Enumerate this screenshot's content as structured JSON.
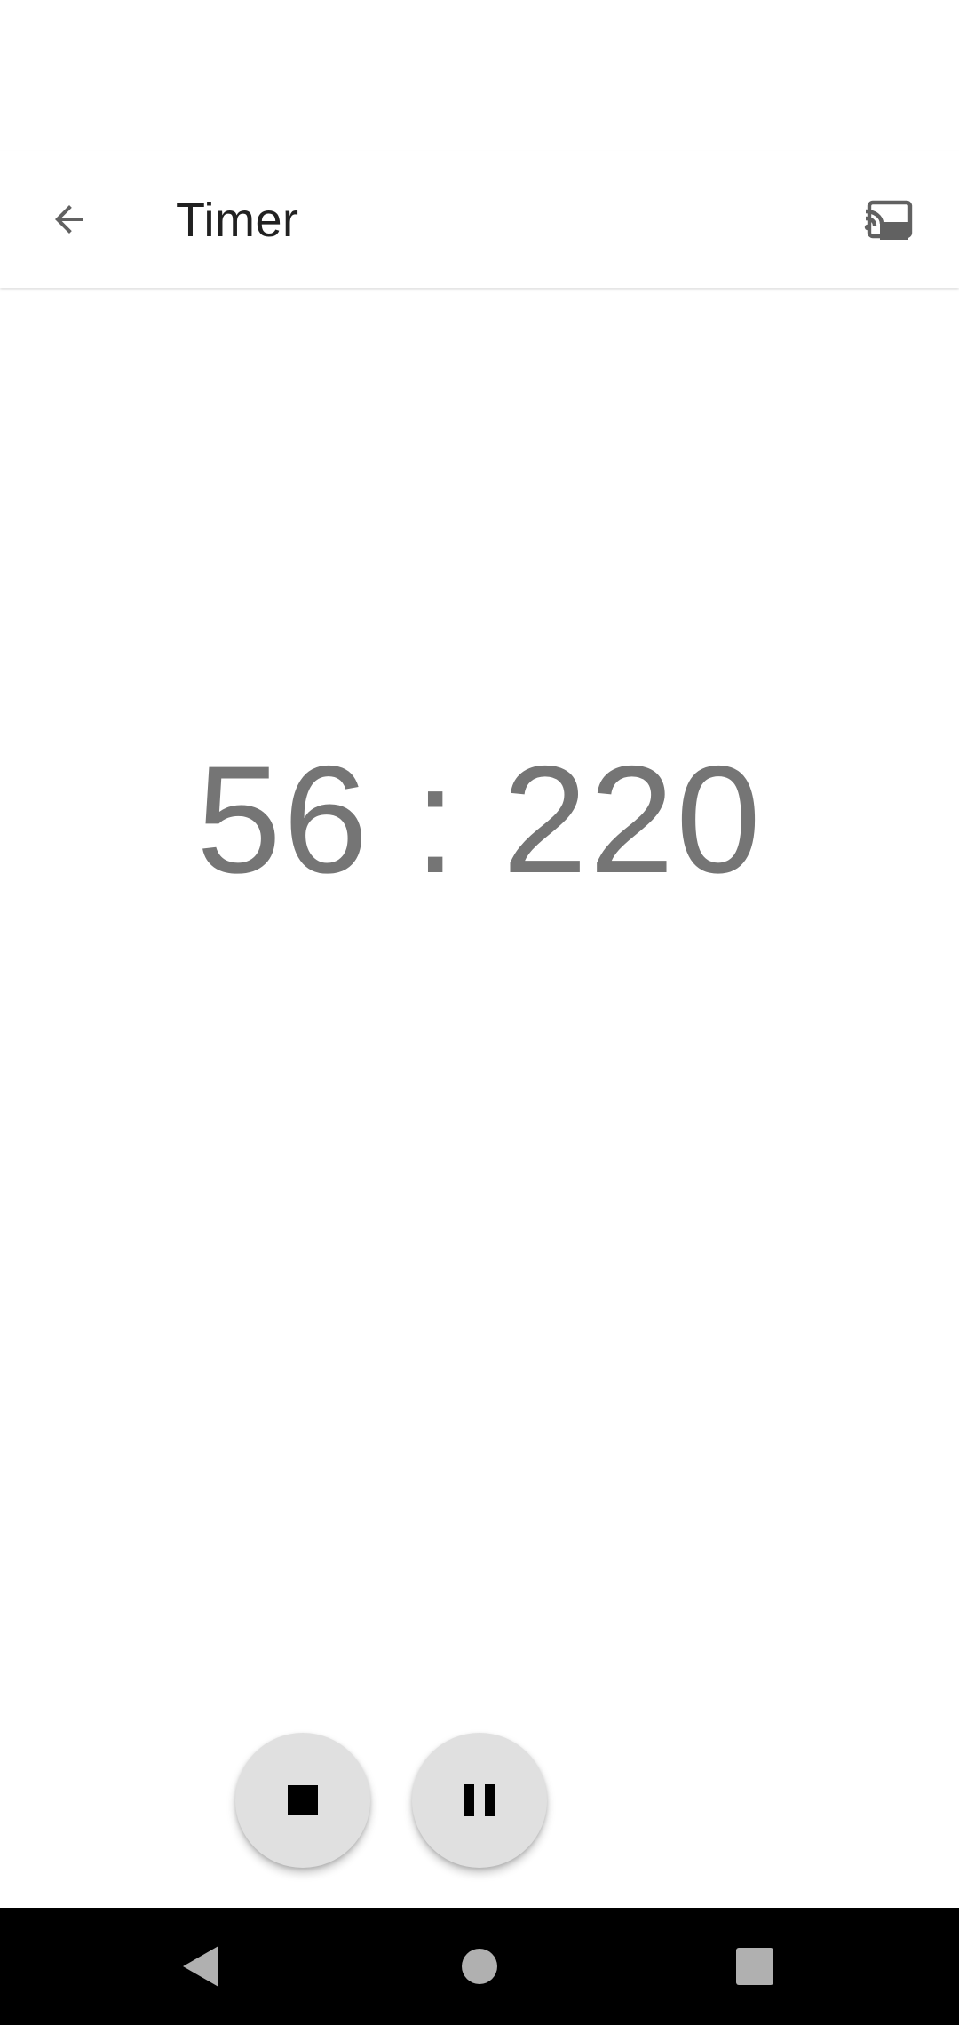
{
  "app_bar": {
    "title": "Timer",
    "back_icon": "arrow-left-icon",
    "action_icon": "cast-icon"
  },
  "timer": {
    "display": "56 : 220"
  },
  "controls": {
    "stop_icon": "stop-icon",
    "pause_icon": "pause-icon"
  },
  "navigation_bar": {
    "back_icon": "nav-back-icon",
    "home_icon": "nav-home-icon",
    "recents_icon": "nav-recents-icon"
  },
  "colors": {
    "timer_text": "#757575",
    "fab_background": "#e0e0e0",
    "nav_background": "#000000"
  }
}
